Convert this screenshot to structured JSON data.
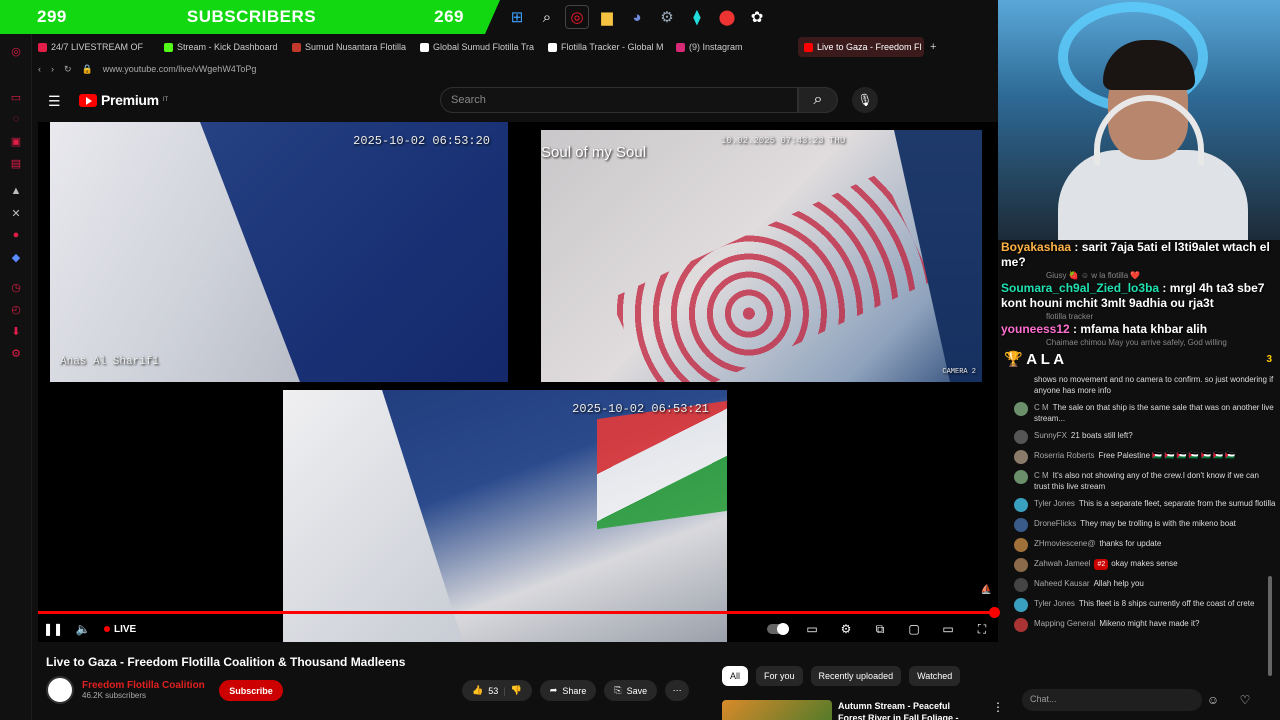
{
  "overlay": {
    "subs_left": "299",
    "label": "SUBSCRIBERS",
    "subs_right": "269"
  },
  "tabs": [
    {
      "label": "24/7 LIVESTREAM OF",
      "color": "#e11d48"
    },
    {
      "label": "Stream - Kick Dashboard",
      "color": "#53fc18"
    },
    {
      "label": "Sumud Nusantara Flotilla",
      "color": "#c0392b"
    },
    {
      "label": "Global Sumud Flotilla Tra",
      "color": "#ffffff"
    },
    {
      "label": "Flotilla Tracker - Global M",
      "color": "#ffffff"
    },
    {
      "label": "(9) Instagram",
      "color": "#d62976"
    },
    {
      "label": "Live to Gaza - Freedom Fl",
      "color": "#ff0000"
    }
  ],
  "address": "www.youtube.com/live/vWgehW4ToPg",
  "yt": {
    "brand": "Premium",
    "region": "IT",
    "search_placeholder": "Search"
  },
  "video": {
    "stamp1": "2025-10-02 06:53:20",
    "stamp2": "10.02.2025 07:43:23 THU",
    "stamp3": "2025-10-02 06:53:21",
    "overlay_text": "Soul of my Soul",
    "cam_label1": "Anas Al Sharif1",
    "cam_label2": "CAMERA 2",
    "live_label": "LIVE"
  },
  "meta": {
    "title": "Live to Gaza - Freedom Flotilla Coalition & Thousand Madleens",
    "channel": "Freedom Flotilla Coalition",
    "subscribers": "46.2K subscribers",
    "subscribe": "Subscribe",
    "likes": "53",
    "share": "Share",
    "save": "Save"
  },
  "chips": [
    "All",
    "For you",
    "Recently uploaded",
    "Watched"
  ],
  "rec": {
    "title": "Autumn Stream - Peaceful Forest River in Fall Foliage -"
  },
  "overlay_chat": [
    {
      "who": "Boyakashaa",
      "text": " : sarit 7aja 5ati el l3ti9alet wtach el me?",
      "cls": ""
    },
    {
      "who": "Soumara_ch9al_Zied_lo3ba",
      "text": " : mrgl 4h ta3 sbe7 kont houni mchit 3mlt 9adhia ou rja3t",
      "cls": "c2"
    },
    {
      "who": "youneess12",
      "text": " : mfama hata khbar alih",
      "cls": "c3"
    }
  ],
  "ghosts": [
    "Giusy 🍓 ☺ w la flotilla ❤️",
    "flotilla tracker",
    "Chaimae chimou May you arrive safely, God willing"
  ],
  "ala": {
    "name": "A L A",
    "count": "3"
  },
  "chat": [
    {
      "author": "",
      "text": "shows no movement and no camera to confirm. so just wondering if anyone has more info",
      "color": "transparent"
    },
    {
      "author": "C M",
      "text": "The sale on that ship is the same sale that was on another live stream...",
      "color": "#6b8e6b"
    },
    {
      "author": "SunnyFX",
      "text": "21 boats still left?",
      "color": "#555"
    },
    {
      "author": "Roserria Roberts",
      "text": "Free Palestine 🇵🇸 🇵🇸 🇵🇸 🇵🇸 🇵🇸 🇵🇸 🇵🇸",
      "color": "#8a7a6a"
    },
    {
      "author": "C M",
      "text": "It's also not showing any of the crew.I don't know if we can trust this live stream",
      "color": "#6b8e6b"
    },
    {
      "author": "Tyler Jones",
      "text": "This is a separate fleet, separate from the sumud flotilla",
      "color": "#3aa0c0"
    },
    {
      "author": "DroneFlicks",
      "text": "They may be trolling is with the mikeno boat",
      "color": "#3a5a8a"
    },
    {
      "author": "ZHmoviescene@",
      "text": "thanks for update",
      "color": "#a0703a"
    },
    {
      "author": "Zahwah Jameel",
      "text": "okay makes sense",
      "color": "#8a6a4a",
      "badge": "#2"
    },
    {
      "author": "Naheed Kausar",
      "text": "Allah help you",
      "color": "#444"
    },
    {
      "author": "Tyler Jones",
      "text": "This fleet is 8 ships currently off the coast of crete",
      "color": "#3aa0c0"
    },
    {
      "author": "Mapping General",
      "text": "Mikeno might have made it?",
      "color": "#aa3333"
    }
  ],
  "chat_placeholder": "Chat..."
}
